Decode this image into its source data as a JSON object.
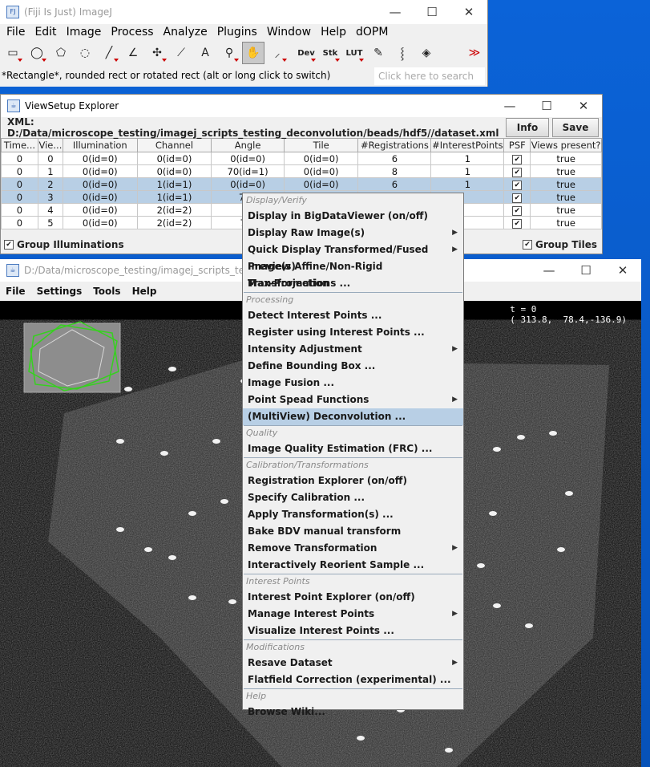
{
  "fiji": {
    "title": "(Fiji Is Just) ImageJ",
    "menus": [
      "File",
      "Edit",
      "Image",
      "Process",
      "Analyze",
      "Plugins",
      "Window",
      "Help",
      "dOPM"
    ],
    "tools": [
      {
        "name": "rectangle-tool-icon",
        "glyph": "▭"
      },
      {
        "name": "oval-tool-icon",
        "glyph": "◯"
      },
      {
        "name": "polygon-tool-icon",
        "glyph": "⬠"
      },
      {
        "name": "freehand-tool-icon",
        "glyph": "◌"
      },
      {
        "name": "line-tool-icon",
        "glyph": "╱"
      },
      {
        "name": "angle-tool-icon",
        "glyph": "∠"
      },
      {
        "name": "point-tool-icon",
        "glyph": "✣"
      },
      {
        "name": "wand-tool-icon",
        "glyph": "⟋"
      },
      {
        "name": "text-tool-icon",
        "glyph": "A"
      },
      {
        "name": "magnifier-tool-icon",
        "glyph": "⚲"
      },
      {
        "name": "hand-tool-icon",
        "glyph": "✋"
      },
      {
        "name": "dropper-tool-icon",
        "glyph": "⸝"
      },
      {
        "name": "dev-tool-icon",
        "glyph": "Dev"
      },
      {
        "name": "stk-tool-icon",
        "glyph": "Stk"
      },
      {
        "name": "lut-tool-icon",
        "glyph": "LUT"
      },
      {
        "name": "pencil-tool-icon",
        "glyph": "✎"
      },
      {
        "name": "brush-tool-icon",
        "glyph": "⸾"
      },
      {
        "name": "flood-fill-tool-icon",
        "glyph": "◈"
      },
      {
        "name": "blank-tool-icon",
        "glyph": ""
      },
      {
        "name": "more-tools-icon",
        "glyph": "≫"
      }
    ],
    "status": "*Rectangle*, rounded rect or rotated rect (alt or long click to switch)",
    "search_placeholder": "Click here to search"
  },
  "viewsetup": {
    "title": "ViewSetup Explorer",
    "xml": "XML: D:/Data/microscope_testing/imagej_scripts_testing_deconvolution/beads/hdf5//dataset.xml",
    "info_label": "Info",
    "save_label": "Save",
    "columns": [
      "Time...",
      "Vie...",
      "Illumination",
      "Channel",
      "Angle",
      "Tile",
      "#Registrations",
      "#InterestPoints",
      "PSF",
      "Views present?"
    ],
    "rows": [
      {
        "time": "0",
        "view": "0",
        "illum": "0(id=0)",
        "channel": "0(id=0)",
        "angle": "0(id=0)",
        "tile": "0(id=0)",
        "reg": "6",
        "ip": "1",
        "psf": "✔",
        "present": "true",
        "selected": false
      },
      {
        "time": "0",
        "view": "1",
        "illum": "0(id=0)",
        "channel": "0(id=0)",
        "angle": "70(id=1)",
        "tile": "0(id=0)",
        "reg": "8",
        "ip": "1",
        "psf": "✔",
        "present": "true",
        "selected": false
      },
      {
        "time": "0",
        "view": "2",
        "illum": "0(id=0)",
        "channel": "1(id=1)",
        "angle": "0(id=0)",
        "tile": "0(id=0)",
        "reg": "6",
        "ip": "1",
        "psf": "✔",
        "present": "true",
        "selected": true
      },
      {
        "time": "0",
        "view": "3",
        "illum": "0(id=0)",
        "channel": "1(id=1)",
        "angle": "70(i",
        "tile": "",
        "reg": "",
        "ip": "",
        "psf": "✔",
        "present": "true",
        "selected": true
      },
      {
        "time": "0",
        "view": "4",
        "illum": "0(id=0)",
        "channel": "2(id=2)",
        "angle": "0(i",
        "tile": "",
        "reg": "",
        "ip": "",
        "psf": "✔",
        "present": "true",
        "selected": false
      },
      {
        "time": "0",
        "view": "5",
        "illum": "0(id=0)",
        "channel": "2(id=2)",
        "angle": "70(",
        "tile": "",
        "reg": "",
        "ip": "",
        "psf": "✔",
        "present": "true",
        "selected": false
      }
    ],
    "group_illuminations": "Group Illuminations",
    "group_tiles": "Group Tiles"
  },
  "bdv": {
    "title": "D:/Data/microscope_testing/imagej_scripts_testing_",
    "menus": [
      "File",
      "Settings",
      "Tools",
      "Help"
    ],
    "overlay_t": "t = 0",
    "overlay_coords": "( 313.8,  78.4,-136.9)"
  },
  "context_menu": {
    "sections": [
      {
        "header": "Display/Verify",
        "items": [
          {
            "label": "Display in BigDataViewer (on/off)",
            "sub": false
          },
          {
            "label": "Display Raw Image(s)",
            "sub": true
          },
          {
            "label": "Quick Display Transformed/Fused Image(s)",
            "sub": true
          },
          {
            "label": "Preview Affine/Non-Rigid Transformations ...",
            "sub": false
          },
          {
            "label": "Max-Projection",
            "sub": false
          }
        ]
      },
      {
        "header": "Processing",
        "items": [
          {
            "label": "Detect Interest Points ...",
            "sub": false
          },
          {
            "label": "Register using Interest Points ...",
            "sub": false
          },
          {
            "label": "Intensity Adjustment",
            "sub": true
          },
          {
            "label": "Define Bounding Box ...",
            "sub": false
          },
          {
            "label": "Image Fusion ...",
            "sub": false
          },
          {
            "label": "Point Spead Functions",
            "sub": true
          },
          {
            "label": "(MultiView) Deconvolution ...",
            "sub": false,
            "highlight": true
          }
        ]
      },
      {
        "header": "Quality",
        "items": [
          {
            "label": "Image Quality Estimation (FRC) ...",
            "sub": false
          }
        ]
      },
      {
        "header": "Calibration/Transformations",
        "items": [
          {
            "label": "Registration Explorer (on/off)",
            "sub": false
          },
          {
            "label": "Specify Calibration ...",
            "sub": false
          },
          {
            "label": "Apply Transformation(s) ...",
            "sub": false
          },
          {
            "label": "Bake BDV manual transform",
            "sub": false
          },
          {
            "label": "Remove Transformation",
            "sub": true
          },
          {
            "label": "Interactively Reorient Sample ...",
            "sub": false
          }
        ]
      },
      {
        "header": "Interest Points",
        "items": [
          {
            "label": "Interest Point Explorer (on/off)",
            "sub": false
          },
          {
            "label": "Manage Interest Points",
            "sub": true
          },
          {
            "label": "Visualize Interest Points ...",
            "sub": false
          }
        ]
      },
      {
        "header": "Modifications",
        "items": [
          {
            "label": "Resave Dataset",
            "sub": true
          },
          {
            "label": "Flatfield Correction (experimental) ...",
            "sub": false
          }
        ]
      },
      {
        "header": "Help",
        "items": [
          {
            "label": "Browse Wiki...",
            "sub": false
          }
        ]
      }
    ]
  }
}
